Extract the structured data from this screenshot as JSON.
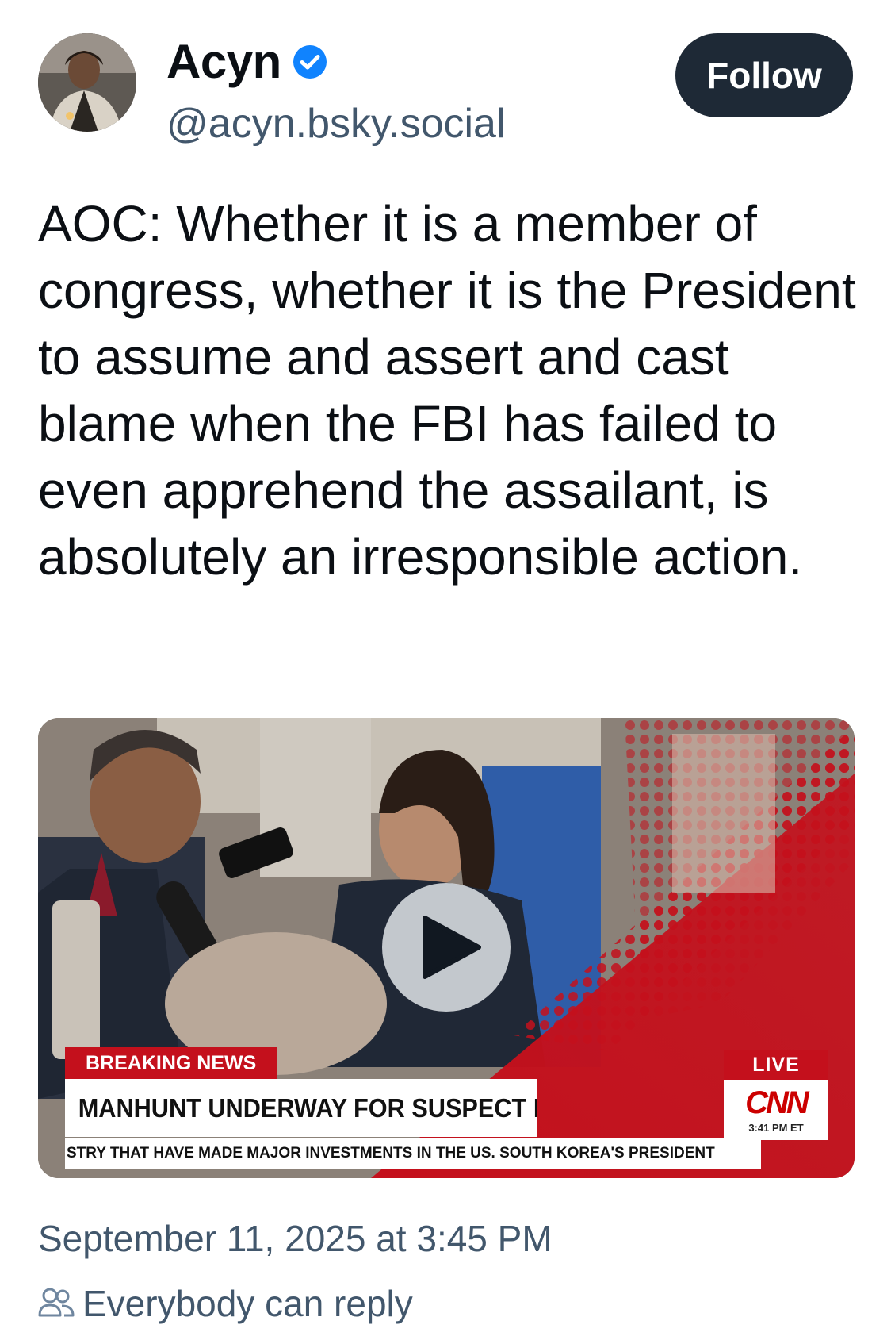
{
  "author": {
    "display_name": "Acyn",
    "handle": "@acyn.bsky.social",
    "verified_color": "#1083fe"
  },
  "follow_button": {
    "label": "Follow"
  },
  "post": {
    "text": "AOC: Whether it is a member of congress, whether it is the President to assume and assert and cast blame when the FBI has failed to even apprehend the assailant, is absolutely an irresponsible action."
  },
  "video": {
    "breaking_label": "BREAKING NEWS",
    "headline": "MANHUNT UNDERWAY FOR SUSPECT IN CHARLIE",
    "ticker": "STRY THAT HAVE MADE MAJOR INVESTMENTS IN THE US. SOUTH KOREA'S PRESIDENT",
    "live_label": "LIVE",
    "network_logo": "CNN",
    "network_time": "3:41 PM ET",
    "accent_color": "#c4101c"
  },
  "footer": {
    "timestamp": "September 11, 2025 at 3:45 PM",
    "reply_setting": "Everybody can reply",
    "reply_icon": "people-icon"
  }
}
